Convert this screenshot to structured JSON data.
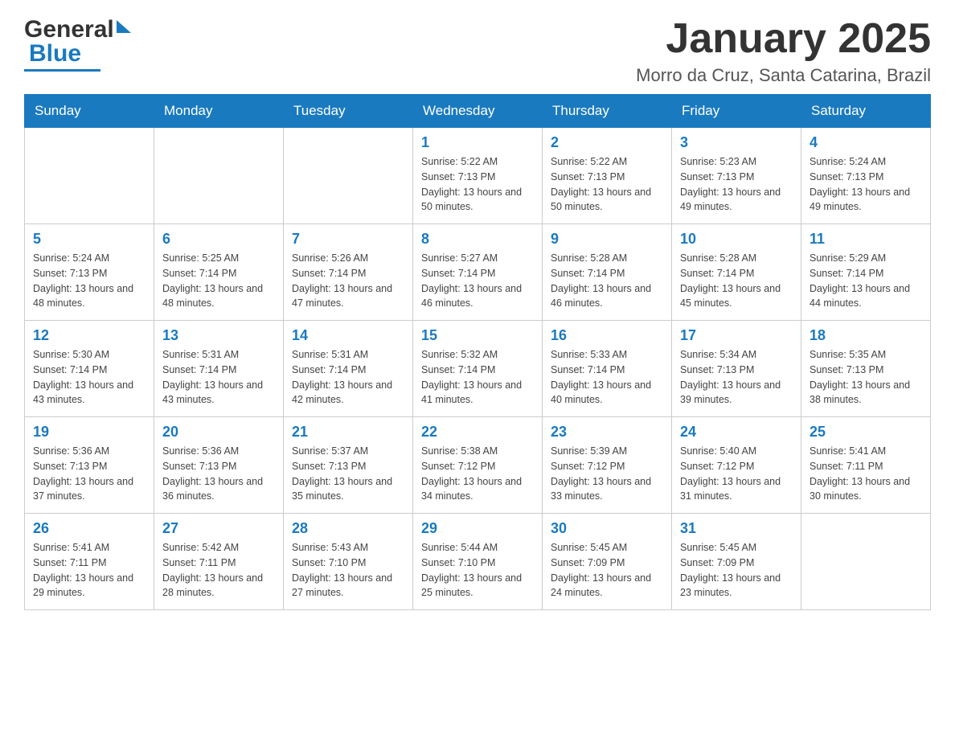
{
  "header": {
    "month_title": "January 2025",
    "location": "Morro da Cruz, Santa Catarina, Brazil",
    "logo_general": "General",
    "logo_blue": "Blue"
  },
  "days_of_week": [
    "Sunday",
    "Monday",
    "Tuesday",
    "Wednesday",
    "Thursday",
    "Friday",
    "Saturday"
  ],
  "weeks": [
    [
      {
        "day": "",
        "info": ""
      },
      {
        "day": "",
        "info": ""
      },
      {
        "day": "",
        "info": ""
      },
      {
        "day": "1",
        "info": "Sunrise: 5:22 AM\nSunset: 7:13 PM\nDaylight: 13 hours\nand 50 minutes."
      },
      {
        "day": "2",
        "info": "Sunrise: 5:22 AM\nSunset: 7:13 PM\nDaylight: 13 hours\nand 50 minutes."
      },
      {
        "day": "3",
        "info": "Sunrise: 5:23 AM\nSunset: 7:13 PM\nDaylight: 13 hours\nand 49 minutes."
      },
      {
        "day": "4",
        "info": "Sunrise: 5:24 AM\nSunset: 7:13 PM\nDaylight: 13 hours\nand 49 minutes."
      }
    ],
    [
      {
        "day": "5",
        "info": "Sunrise: 5:24 AM\nSunset: 7:13 PM\nDaylight: 13 hours\nand 48 minutes."
      },
      {
        "day": "6",
        "info": "Sunrise: 5:25 AM\nSunset: 7:14 PM\nDaylight: 13 hours\nand 48 minutes."
      },
      {
        "day": "7",
        "info": "Sunrise: 5:26 AM\nSunset: 7:14 PM\nDaylight: 13 hours\nand 47 minutes."
      },
      {
        "day": "8",
        "info": "Sunrise: 5:27 AM\nSunset: 7:14 PM\nDaylight: 13 hours\nand 46 minutes."
      },
      {
        "day": "9",
        "info": "Sunrise: 5:28 AM\nSunset: 7:14 PM\nDaylight: 13 hours\nand 46 minutes."
      },
      {
        "day": "10",
        "info": "Sunrise: 5:28 AM\nSunset: 7:14 PM\nDaylight: 13 hours\nand 45 minutes."
      },
      {
        "day": "11",
        "info": "Sunrise: 5:29 AM\nSunset: 7:14 PM\nDaylight: 13 hours\nand 44 minutes."
      }
    ],
    [
      {
        "day": "12",
        "info": "Sunrise: 5:30 AM\nSunset: 7:14 PM\nDaylight: 13 hours\nand 43 minutes."
      },
      {
        "day": "13",
        "info": "Sunrise: 5:31 AM\nSunset: 7:14 PM\nDaylight: 13 hours\nand 43 minutes."
      },
      {
        "day": "14",
        "info": "Sunrise: 5:31 AM\nSunset: 7:14 PM\nDaylight: 13 hours\nand 42 minutes."
      },
      {
        "day": "15",
        "info": "Sunrise: 5:32 AM\nSunset: 7:14 PM\nDaylight: 13 hours\nand 41 minutes."
      },
      {
        "day": "16",
        "info": "Sunrise: 5:33 AM\nSunset: 7:14 PM\nDaylight: 13 hours\nand 40 minutes."
      },
      {
        "day": "17",
        "info": "Sunrise: 5:34 AM\nSunset: 7:13 PM\nDaylight: 13 hours\nand 39 minutes."
      },
      {
        "day": "18",
        "info": "Sunrise: 5:35 AM\nSunset: 7:13 PM\nDaylight: 13 hours\nand 38 minutes."
      }
    ],
    [
      {
        "day": "19",
        "info": "Sunrise: 5:36 AM\nSunset: 7:13 PM\nDaylight: 13 hours\nand 37 minutes."
      },
      {
        "day": "20",
        "info": "Sunrise: 5:36 AM\nSunset: 7:13 PM\nDaylight: 13 hours\nand 36 minutes."
      },
      {
        "day": "21",
        "info": "Sunrise: 5:37 AM\nSunset: 7:13 PM\nDaylight: 13 hours\nand 35 minutes."
      },
      {
        "day": "22",
        "info": "Sunrise: 5:38 AM\nSunset: 7:12 PM\nDaylight: 13 hours\nand 34 minutes."
      },
      {
        "day": "23",
        "info": "Sunrise: 5:39 AM\nSunset: 7:12 PM\nDaylight: 13 hours\nand 33 minutes."
      },
      {
        "day": "24",
        "info": "Sunrise: 5:40 AM\nSunset: 7:12 PM\nDaylight: 13 hours\nand 31 minutes."
      },
      {
        "day": "25",
        "info": "Sunrise: 5:41 AM\nSunset: 7:11 PM\nDaylight: 13 hours\nand 30 minutes."
      }
    ],
    [
      {
        "day": "26",
        "info": "Sunrise: 5:41 AM\nSunset: 7:11 PM\nDaylight: 13 hours\nand 29 minutes."
      },
      {
        "day": "27",
        "info": "Sunrise: 5:42 AM\nSunset: 7:11 PM\nDaylight: 13 hours\nand 28 minutes."
      },
      {
        "day": "28",
        "info": "Sunrise: 5:43 AM\nSunset: 7:10 PM\nDaylight: 13 hours\nand 27 minutes."
      },
      {
        "day": "29",
        "info": "Sunrise: 5:44 AM\nSunset: 7:10 PM\nDaylight: 13 hours\nand 25 minutes."
      },
      {
        "day": "30",
        "info": "Sunrise: 5:45 AM\nSunset: 7:09 PM\nDaylight: 13 hours\nand 24 minutes."
      },
      {
        "day": "31",
        "info": "Sunrise: 5:45 AM\nSunset: 7:09 PM\nDaylight: 13 hours\nand 23 minutes."
      },
      {
        "day": "",
        "info": ""
      }
    ]
  ]
}
